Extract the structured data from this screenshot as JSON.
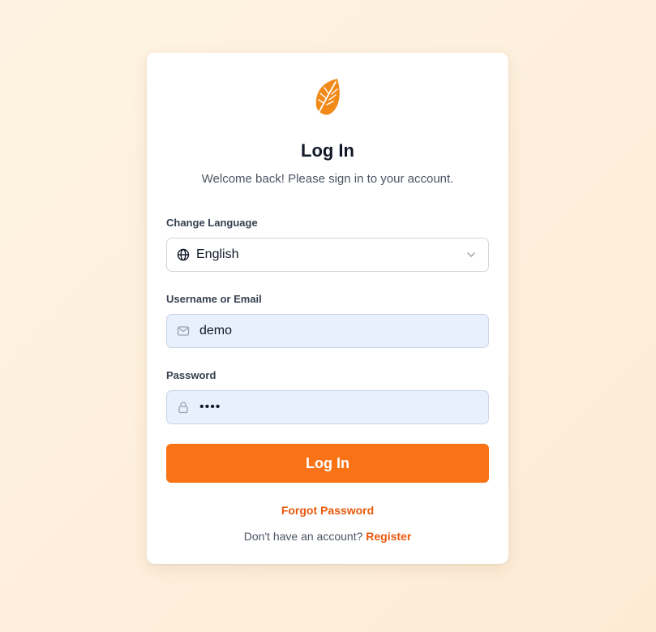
{
  "login": {
    "title": "Log In",
    "subtitle": "Welcome back! Please sign in to your account.",
    "language": {
      "label": "Change Language",
      "selected": "English"
    },
    "username": {
      "label": "Username or Email",
      "value": "demo"
    },
    "password": {
      "label": "Password",
      "masked_value": "••••"
    },
    "submit_label": "Log In",
    "forgot_label": "Forgot Password",
    "register_prompt": "Don't have an account?",
    "register_label": "Register"
  },
  "icons": {
    "logo": "leaf-icon",
    "language": "globe-icon",
    "language_dropdown": "chevron-down-icon",
    "username": "mail-icon",
    "password": "lock-icon"
  },
  "colors": {
    "accent": "#f97316",
    "link": "#ea580c",
    "input_fill": "#e8effd",
    "background": "#fef3e2"
  }
}
